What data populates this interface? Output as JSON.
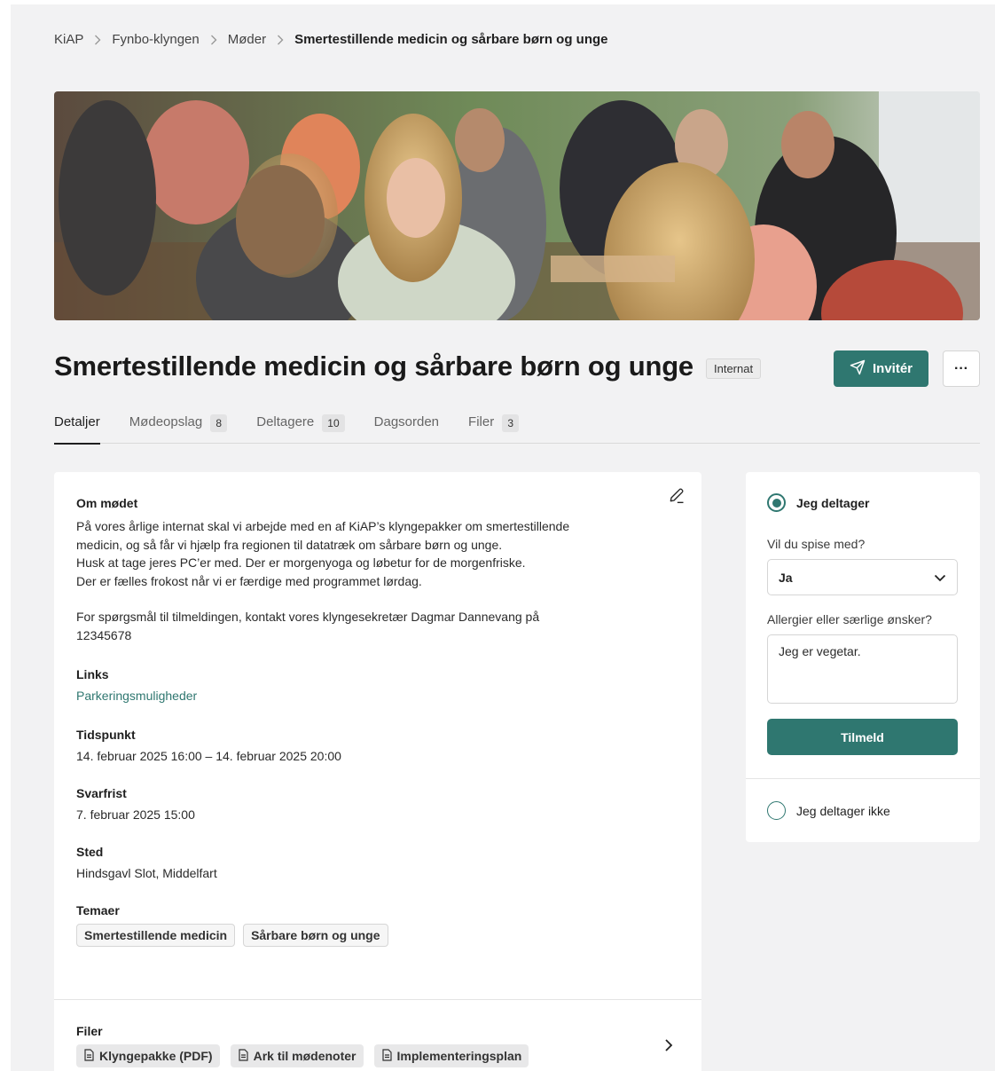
{
  "breadcrumb": {
    "items": [
      "KiAP",
      "Fynbo-klyngen",
      "Møder"
    ],
    "current": "Smertestillende medicin og sårbare børn og unge"
  },
  "hero": {
    "image": "meeting-photo"
  },
  "title": "Smertestillende medicin og sårbare børn og unge",
  "badge": "Internat",
  "actions": {
    "invite_label": "Invitér",
    "more_label": "···"
  },
  "tabs": [
    {
      "label": "Detaljer",
      "count": ""
    },
    {
      "label": "Mødeopslag",
      "count": "8"
    },
    {
      "label": "Deltagere",
      "count": "10"
    },
    {
      "label": "Dagsorden",
      "count": ""
    },
    {
      "label": "Filer",
      "count": "3"
    }
  ],
  "about": {
    "title": "Om mødet",
    "para1_lines": [
      "På vores årlige internat skal vi arbejde med en af KiAP’s klyngepakker om smertestillende",
      "medicin, og så får vi hjælp fra regionen til datatræk om sårbare børn og unge.",
      "Husk at tage jeres PC’er med. Der er morgenyoga og løbetur for de morgenfriske.",
      "Der er fælles frokost når vi er færdige med programmet lørdag."
    ],
    "para2_lines": [
      "For spørgsmål til tilmeldingen, kontakt vores klyngesekretær Dagmar Dannevang på",
      "12345678"
    ]
  },
  "links": {
    "title": "Links",
    "items": [
      "Parkeringsmuligheder"
    ]
  },
  "time": {
    "title": "Tidspunkt",
    "value": "14. februar 2025 16:00 – 14. februar 2025 20:00"
  },
  "deadline": {
    "title": "Svarfrist",
    "value": "7. februar 2025 15:00"
  },
  "place": {
    "title": "Sted",
    "value": "Hindsgavl Slot, Middelfart"
  },
  "themes": {
    "title": "Temaer",
    "items": [
      "Smertestillende medicin",
      "Sårbare børn og unge"
    ]
  },
  "files": {
    "title": "Filer",
    "items": [
      "Klyngepakke (PDF)",
      "Ark til mødenoter",
      "Implementeringsplan"
    ]
  },
  "rsvp": {
    "attending_label": "Jeg deltager",
    "eat_label": "Vil du spise med?",
    "eat_value": "Ja",
    "allergy_label": "Allergier eller særlige ønsker?",
    "allergy_value": "Jeg er vegetar.",
    "submit_label": "Tilmeld",
    "not_attending_label": "Jeg deltager ikke"
  },
  "colors": {
    "accent": "#2f7770",
    "page_bg": "#f2f2f3"
  }
}
